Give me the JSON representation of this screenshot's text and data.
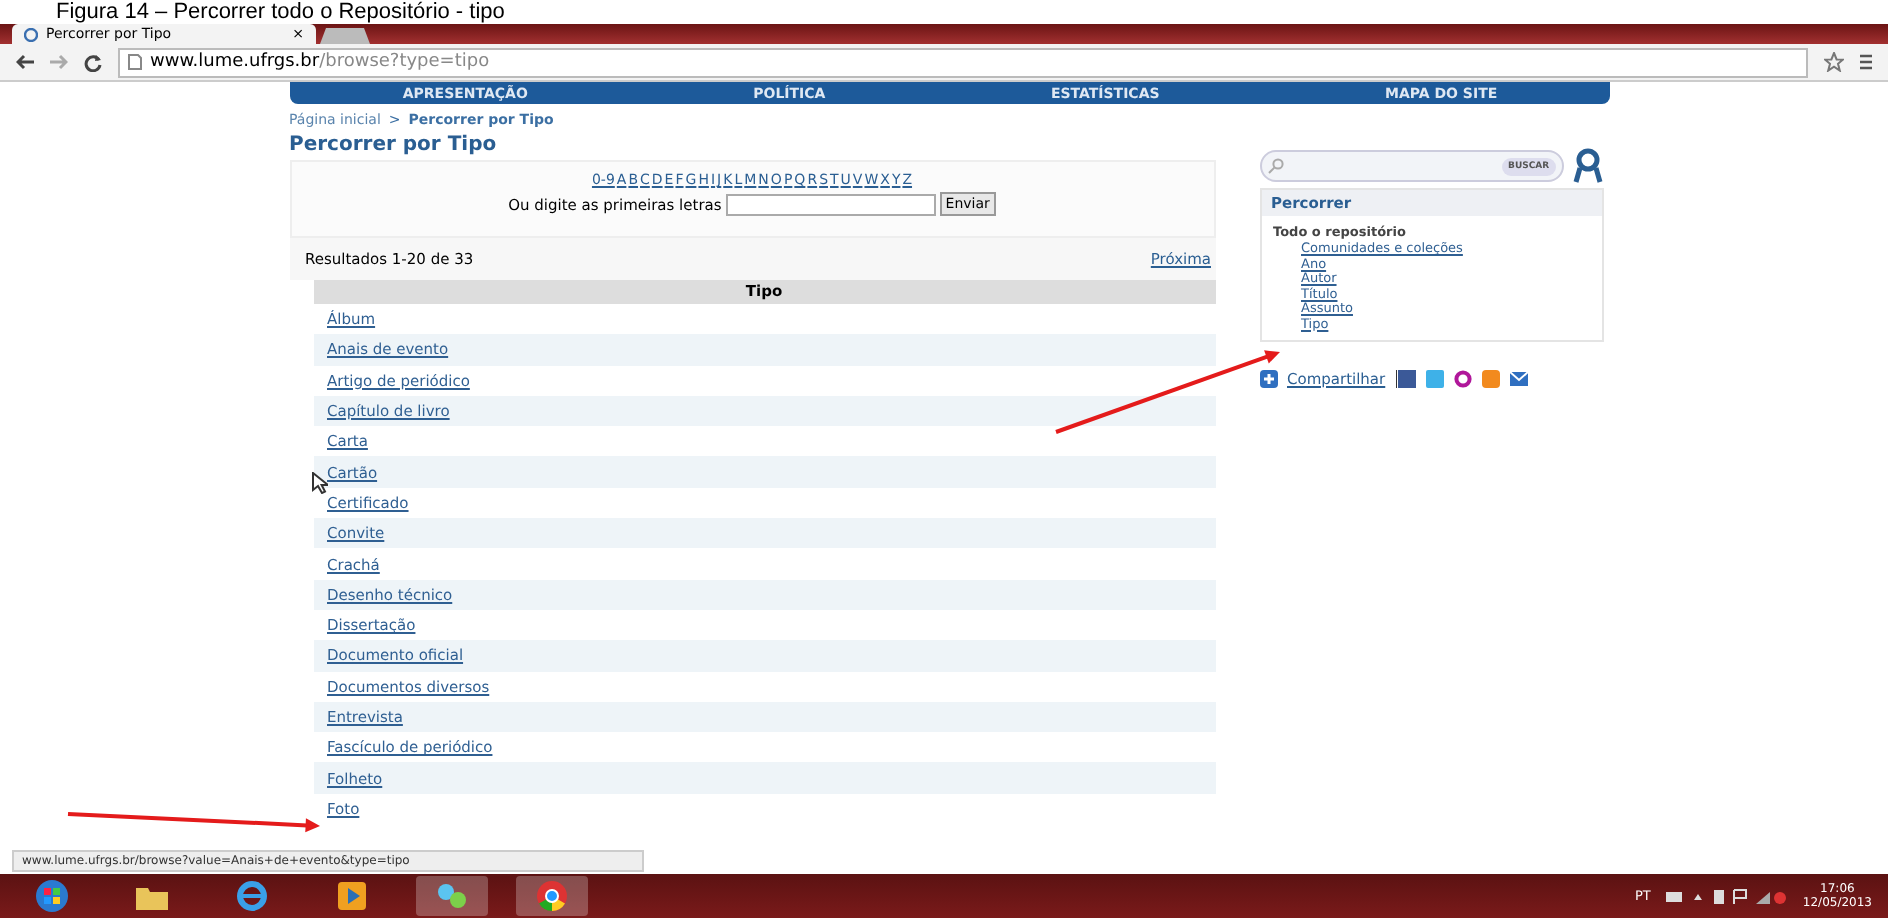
{
  "caption": "Figura 14 – Percorrer todo o Repositório - tipo",
  "browser": {
    "tab_title": "Percorrer por Tipo",
    "tab_close": "×",
    "url_host": "www.lume.ufrgs.br",
    "url_path": "/browse?type=tipo"
  },
  "nav": [
    "APRESENTAÇÃO",
    "POLÍTICA",
    "ESTATÍSTICAS",
    "MAPA DO SITE"
  ],
  "breadcrumb": {
    "home": "Página inicial",
    "separator": ">",
    "current": "Percorrer por Tipo"
  },
  "page_title": "Percorrer por Tipo",
  "alphabet": [
    "0-9",
    "A",
    "B",
    "C",
    "D",
    "E",
    "F",
    "G",
    "H",
    "I",
    "J",
    "K",
    "L",
    "M",
    "N",
    "O",
    "P",
    "Q",
    "R",
    "S",
    "T",
    "U",
    "V",
    "W",
    "X",
    "Y",
    "Z"
  ],
  "jump_label": "Ou digite as primeiras letras",
  "jump_button": "Enviar",
  "results": "Resultados 1-20 de 33",
  "next": "Próxima",
  "table": {
    "column": "Tipo",
    "rows": [
      "Álbum",
      "Anais de evento",
      "Artigo de periódico",
      "Capítulo de livro",
      "Carta",
      "Cartão",
      "Certificado",
      "Convite",
      "Crachá",
      "Desenho técnico",
      "Dissertação",
      "Documento oficial",
      "Documentos diversos",
      "Entrevista",
      "Fascículo de periódico",
      "Folheto",
      "Foto"
    ]
  },
  "sidebar": {
    "search_button": "BUSCAR",
    "title": "Percorrer",
    "scope": "Todo o repositório",
    "links": [
      "Comunidades e coleções",
      "Ano",
      "Autor",
      "Título",
      "Assunto",
      "Tipo"
    ],
    "share": "Compartilhar"
  },
  "status_url": "www.lume.ufrgs.br/browse?value=Anais+de+evento&type=tipo",
  "taskbar": {
    "language": "PT",
    "time": "17:06",
    "date": "12/05/2013"
  }
}
